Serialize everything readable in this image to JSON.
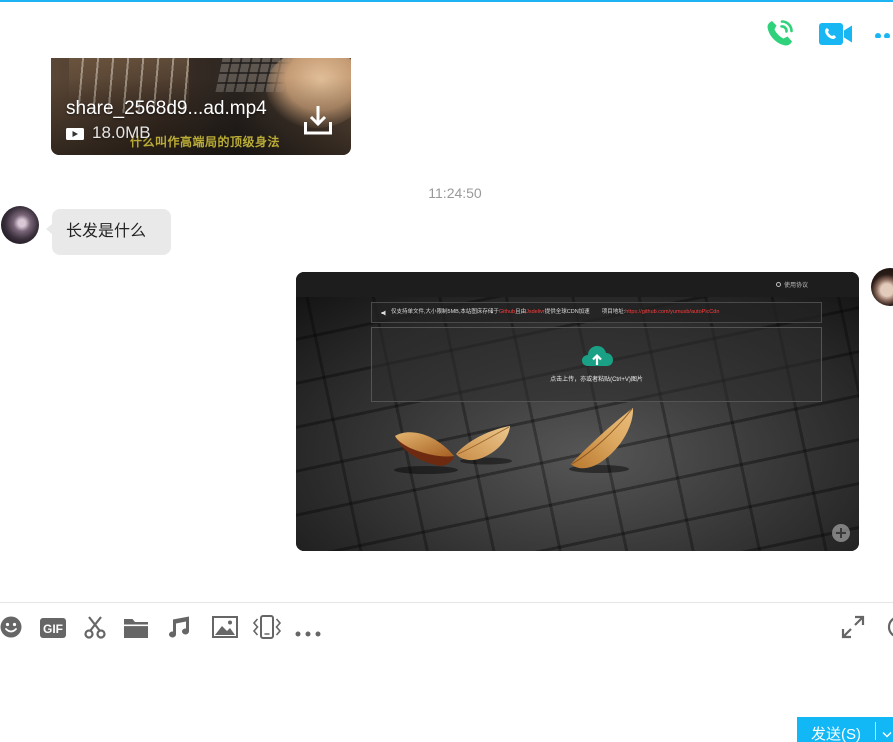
{
  "header": {
    "icons": [
      "phone-call-icon",
      "video-call-icon",
      "more-icon"
    ],
    "colors": {
      "call": "#2fd27b",
      "video": "#18b6f3",
      "accent_line": "#1eb3f3"
    }
  },
  "messages": {
    "video_file": {
      "file_name": "share_2568d9...ad.mp4",
      "file_size": "18.0MB",
      "thumbnail_caption": "什么叫作高端局的顶级身法",
      "icons": [
        "play-icon",
        "download-icon"
      ]
    },
    "timestamp": "11:24:50",
    "incoming_text": {
      "text": "长发是什么"
    },
    "outgoing_image": {
      "terms_link": "使用协议",
      "notice": {
        "text_1": "仅支持单文件,大小限制5MB,本站图床存储于",
        "highlight_1": "Github",
        "text_2": "且由",
        "highlight_2": "Jsdelivr",
        "text_3": "提供全球CDN加速",
        "project_label": "项目地址:",
        "project_url": "https://github.com/yumusb/autoPicCdn"
      },
      "upload_hint": "点击上传，亦或者粘贴(Ctrl+V)图片",
      "highlight_color": "#ff3b3b",
      "upload_icon_color": "#1aa185"
    }
  },
  "toolbar": {
    "gif_label": "GIF",
    "left_icons": [
      "emoji-icon",
      "gif-icon",
      "scissors-icon",
      "folder-icon",
      "music-icon",
      "image-icon",
      "shake-icon",
      "more-icon"
    ],
    "right_icons": [
      "expand-icon",
      "history-icon"
    ],
    "icon_color": "#666666"
  },
  "send_button": {
    "label": "发送(S)",
    "color": "#12b7f5"
  }
}
